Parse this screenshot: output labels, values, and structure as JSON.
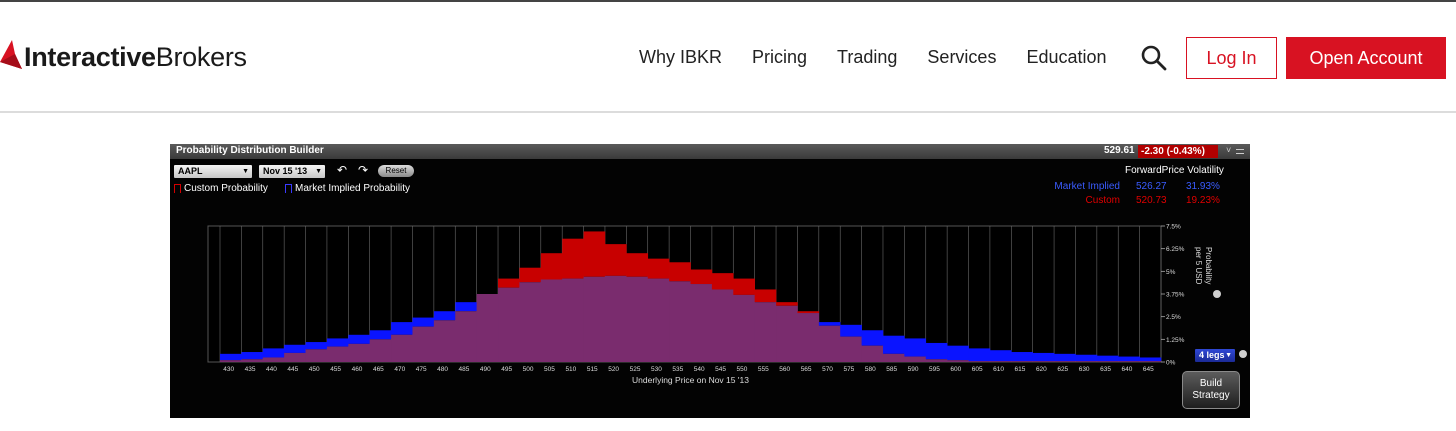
{
  "header": {
    "logo_bold": "Interactive",
    "logo_light": "Brokers",
    "nav": [
      "Why IBKR",
      "Pricing",
      "Trading",
      "Services",
      "Education"
    ],
    "login_label": "Log In",
    "open_account_label": "Open Account",
    "brand_color": "#d81222"
  },
  "tool": {
    "title": "Probability Distribution Builder",
    "last_price": "529.61",
    "change": "-2.30 (-0.43%)",
    "symbol": "AAPL",
    "expiry": "Nov 15 '13",
    "reset_label": "Reset",
    "legend_custom": "Custom Probability",
    "legend_market": "Market Implied Probability",
    "fpv_header": "ForwardPrice Volatility",
    "market_row": {
      "label": "Market Implied",
      "forward": "526.27",
      "vol": "31.93%"
    },
    "custom_row": {
      "label": "Custom",
      "forward": "520.73",
      "vol": "19.23%"
    },
    "legs_label": "4 legs",
    "build_label": "Build\nStrategy"
  },
  "chart_data": {
    "type": "bar",
    "title": "",
    "xlabel": "Underlying Price on Nov 15 '13",
    "ylabel": "Probability per 5 USD",
    "ylim": [
      0,
      7.5
    ],
    "y_ticks": [
      "0%",
      "1.25%",
      "2.5%",
      "3.75%",
      "5%",
      "6.25%",
      "7.5%"
    ],
    "categories": [
      "430",
      "435",
      "440",
      "445",
      "450",
      "455",
      "460",
      "465",
      "470",
      "475",
      "480",
      "485",
      "490",
      "495",
      "500",
      "505",
      "510",
      "515",
      "520",
      "525",
      "530",
      "535",
      "540",
      "545",
      "550",
      "555",
      "560",
      "565",
      "570",
      "575",
      "580",
      "585",
      "590",
      "595",
      "600",
      "605",
      "610",
      "615",
      "620",
      "625",
      "630",
      "635",
      "640",
      "645"
    ],
    "series": [
      {
        "name": "Market Implied Probability",
        "color": "#0a14ff",
        "values": [
          0.45,
          0.55,
          0.75,
          0.95,
          1.1,
          1.3,
          1.5,
          1.75,
          2.2,
          2.45,
          2.8,
          3.3,
          3.75,
          4.1,
          4.4,
          4.55,
          4.6,
          4.7,
          4.75,
          4.7,
          4.6,
          4.45,
          4.3,
          4.0,
          3.7,
          3.3,
          3.1,
          2.7,
          2.2,
          2.05,
          1.75,
          1.45,
          1.3,
          1.05,
          0.9,
          0.75,
          0.65,
          0.55,
          0.5,
          0.45,
          0.4,
          0.35,
          0.3,
          0.25
        ]
      },
      {
        "name": "Custom Probability",
        "color": "#c80000",
        "values": [
          0.1,
          0.15,
          0.25,
          0.5,
          0.7,
          0.85,
          1.0,
          1.25,
          1.5,
          1.95,
          2.3,
          2.8,
          3.75,
          4.6,
          5.2,
          6.0,
          6.8,
          7.2,
          6.5,
          6.0,
          5.7,
          5.5,
          5.1,
          4.9,
          4.6,
          4.0,
          3.3,
          2.8,
          2.0,
          1.4,
          0.9,
          0.45,
          0.3,
          0.15,
          0.1,
          0.05,
          0.05,
          0.05,
          0.05,
          0.05,
          0.05,
          0.05,
          0.05,
          0.05
        ]
      }
    ],
    "overlap_color": "#7a2c6e",
    "grid": true
  }
}
